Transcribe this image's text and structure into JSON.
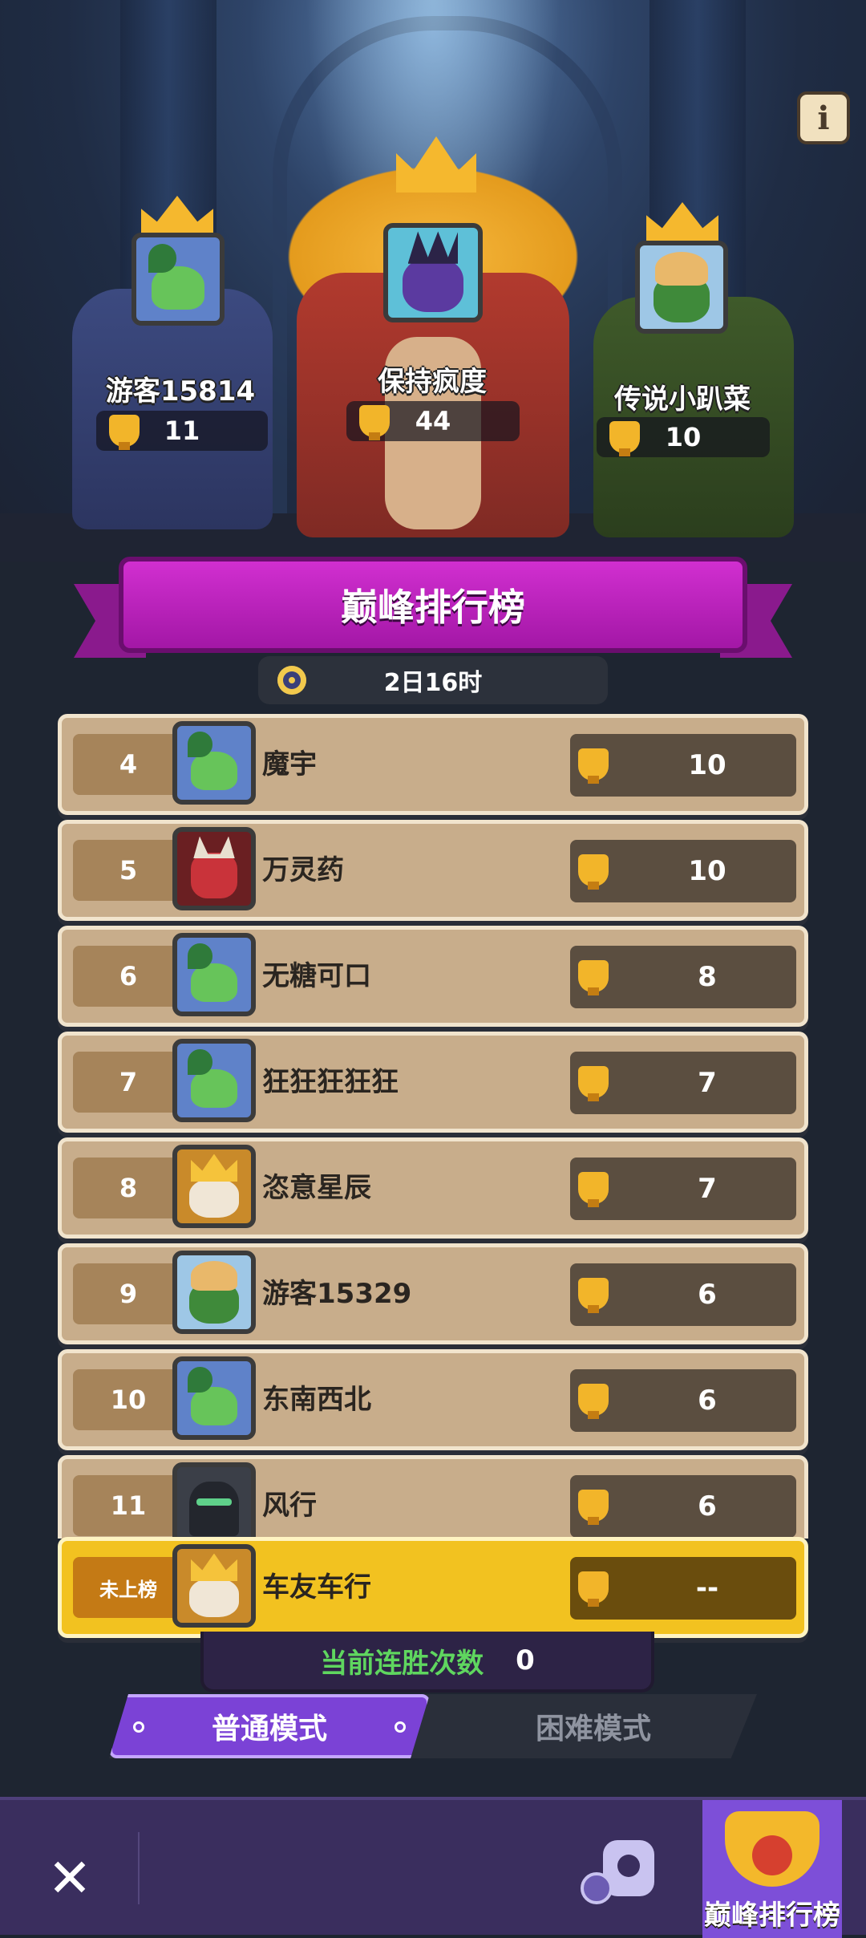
{
  "header": {
    "info_icon": "info-icon"
  },
  "podium": {
    "first": {
      "name": "保持疯度",
      "score": "44",
      "avatar": "wizard"
    },
    "second": {
      "name": "游客15814",
      "score": "11",
      "avatar": "frog"
    },
    "third": {
      "name": "传说小趴菜",
      "score": "10",
      "avatar": "tiger"
    }
  },
  "banner": {
    "title": "巅峰排行榜"
  },
  "timer": {
    "remaining": "2日16时",
    "icon": "clock-icon"
  },
  "leaderboard": {
    "rows": [
      {
        "rank": "4",
        "name": "魔宇",
        "score": "10",
        "avatar": "frog"
      },
      {
        "rank": "5",
        "name": "万灵药",
        "score": "10",
        "avatar": "demon"
      },
      {
        "rank": "6",
        "name": "无糖可口",
        "score": "8",
        "avatar": "frog"
      },
      {
        "rank": "7",
        "name": "狂狂狂狂狂",
        "score": "7",
        "avatar": "frog"
      },
      {
        "rank": "8",
        "name": "恣意星辰",
        "score": "7",
        "avatar": "king"
      },
      {
        "rank": "9",
        "name": "游客15329",
        "score": "6",
        "avatar": "tiger"
      },
      {
        "rank": "10",
        "name": "东南西北",
        "score": "6",
        "avatar": "frog"
      },
      {
        "rank": "11",
        "name": "风行",
        "score": "6",
        "avatar": "ninja"
      }
    ],
    "me": {
      "rank": "未上榜",
      "name": "车友车行",
      "score": "--",
      "avatar": "king"
    }
  },
  "streak": {
    "label": "当前连胜次数",
    "value": "0"
  },
  "modes": {
    "normal": "普通模式",
    "hard": "困难模式",
    "active": "normal"
  },
  "bottom_bar": {
    "close_icon": "close-icon",
    "robot_icon": "robot-clock-icon",
    "rank_tab": "巅峰排行榜"
  },
  "colors": {
    "banner": "#c023c4",
    "row_bg": "#c8ad8b",
    "me_row_bg": "#f2c220",
    "active_mode": "#7b42d6",
    "streak_label": "#5fd65f"
  }
}
